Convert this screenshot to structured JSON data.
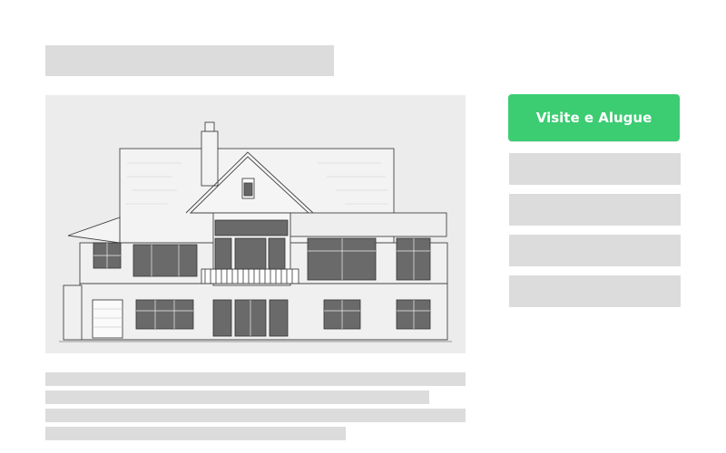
{
  "cta": {
    "label": "Visite e Alugue",
    "color": "#3ccc72",
    "text_color": "#ffffff"
  },
  "hero": {
    "subject": "house-elevation-drawing"
  },
  "placeholder_color": "#dcdcdc"
}
